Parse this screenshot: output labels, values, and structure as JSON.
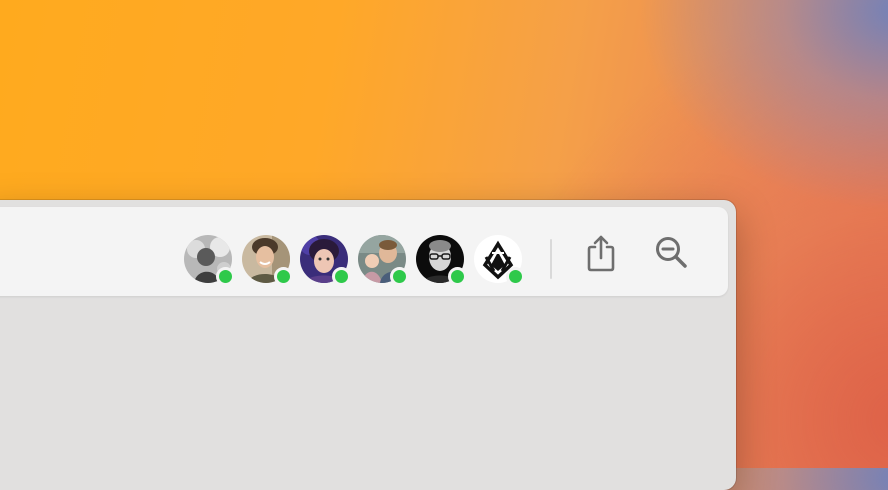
{
  "toolbar": {
    "collaborators": [
      {
        "icon": "avatar-photo-1",
        "status": "online",
        "status_color": "#2ec94a"
      },
      {
        "icon": "avatar-photo-2",
        "status": "online",
        "status_color": "#2ec94a"
      },
      {
        "icon": "avatar-photo-3",
        "status": "online",
        "status_color": "#2ec94a"
      },
      {
        "icon": "avatar-photo-4",
        "status": "online",
        "status_color": "#2ec94a"
      },
      {
        "icon": "avatar-photo-5",
        "status": "online",
        "status_color": "#2ec94a"
      },
      {
        "icon": "avatar-logo-6",
        "status": "online",
        "status_color": "#2ec94a"
      }
    ],
    "share_icon": "share-icon",
    "zoom_icon": "zoom-out-icon"
  }
}
